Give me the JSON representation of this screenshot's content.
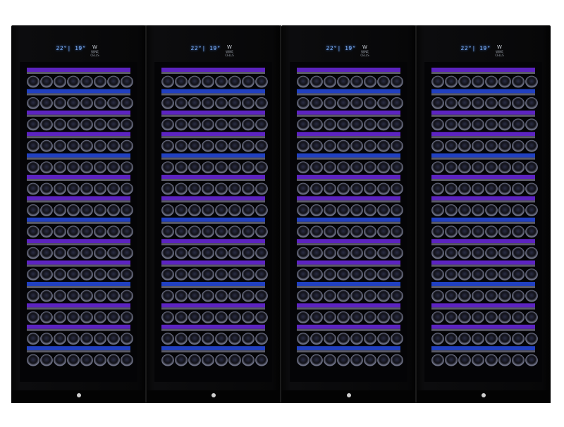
{
  "units": [
    {
      "temp_display": "22°| 19°"
    },
    {
      "temp_display": "22°| 19°"
    },
    {
      "temp_display": "22°| 19°"
    },
    {
      "temp_display": "22°| 19°"
    }
  ],
  "brand_text": "WINE CELLS",
  "colors": {
    "cabinet": "#050505",
    "led_purple": "#7a2dff",
    "led_blue": "#2b54ff",
    "display_blue": "#7fb4ff"
  }
}
